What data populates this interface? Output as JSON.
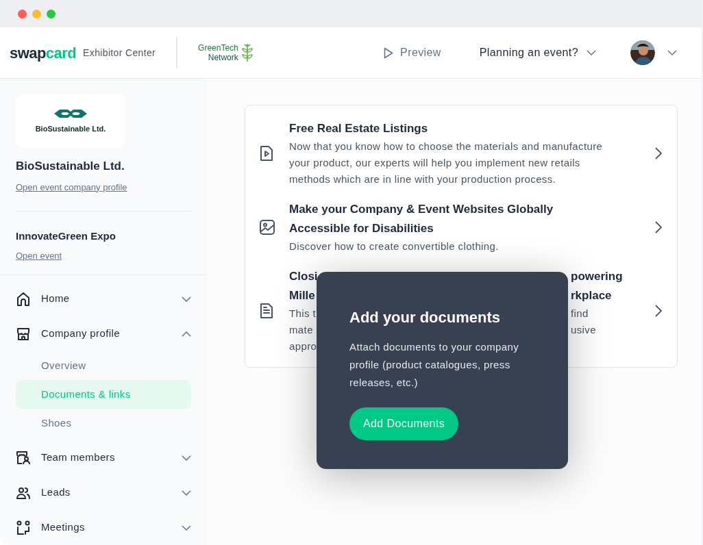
{
  "header": {
    "brand": [
      "swap",
      "card"
    ],
    "subtitle": "Exhibitor Center",
    "partner": [
      "GreenTech",
      "Network"
    ],
    "preview": "Preview",
    "planning": "Planning an event?"
  },
  "sidebar": {
    "logo_text": "BioSustainable Ltd.",
    "company": "BioSustainable Ltd.",
    "company_link": "Open event company profile",
    "event": "InnovateGreen Expo",
    "event_link": "Open event",
    "items": [
      {
        "label": "Home",
        "expanded": false
      },
      {
        "label": "Company profile",
        "expanded": true,
        "children": [
          {
            "label": "Overview",
            "selected": false
          },
          {
            "label": "Documents & links",
            "selected": true
          },
          {
            "label": "Shoes",
            "selected": false
          }
        ]
      },
      {
        "label": "Team members",
        "expanded": false
      },
      {
        "label": "Leads",
        "expanded": false
      },
      {
        "label": "Meetings",
        "expanded": false
      }
    ]
  },
  "cards": [
    {
      "kind": "full",
      "title": "Free Real Estate Listings",
      "description": "Now that you know how to choose the materials and manufacture your product, our experts will help you implement new retails methods which are in line with your production process."
    },
    {
      "kind": "full",
      "title": "Make your Company & Event Websites Globally Accessible for Disabilities",
      "description": "Discover how to create convertible clothing."
    },
    {
      "kind": "partial",
      "title_lines": [
        {
          "left": "Closi",
          "right": "powering"
        },
        {
          "left": "Mille",
          "right": "rkplace"
        }
      ],
      "description_lines": [
        {
          "left": "This t",
          "right": "find"
        },
        {
          "left": "mate",
          "right": "usive"
        },
        {
          "left": "appro"
        }
      ]
    }
  ],
  "popup": {
    "title": "Add your documents",
    "text": "Attach documents to your company profile (product catalogues, press releases, etc.)",
    "button": "Add Documents"
  }
}
